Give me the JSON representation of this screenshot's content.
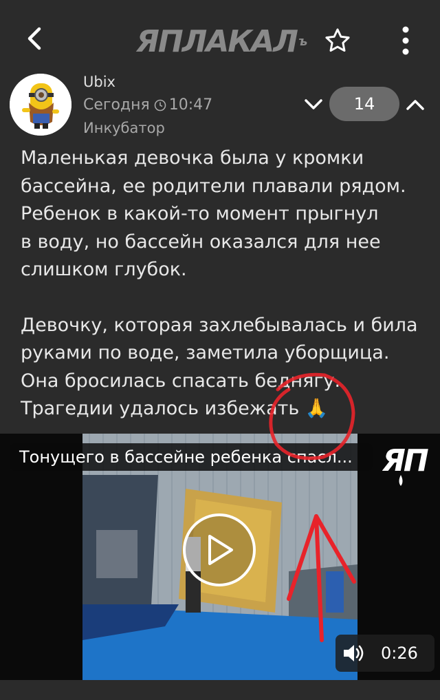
{
  "header": {
    "logo_text": "ЯПЛАКАЛ",
    "logo_sup": "ъ",
    "back_icon": "chevron-left-icon",
    "star_icon": "star-outline-icon",
    "more_icon": "more-vertical-icon"
  },
  "post": {
    "author": "Ubix",
    "time_day": "Сегодня",
    "time_clock": "10:47",
    "author_status": "Инкубатор",
    "rating": "14",
    "paragraphs": [
      "Маленькая девочка была у кромки\nбассейна, ее родители плавали рядом.\nРебенок в какой-то момент прыгнул\nв воду, но бассейн оказался для нее\nслишком глубок.",
      "Девочку, которая захлебывалась и била\nруками по воде, заметила уборщица.\nОна бросилась спасать беднягу.\nТрагедии удалось избежать 🙏"
    ]
  },
  "video": {
    "title": "Тонущего в бассейне ребенка спасл...",
    "logo_text": "ЯП",
    "duration": "0:26"
  },
  "colors": {
    "background": "#2b2b2b",
    "rating_pill": "#6b6b6b",
    "annotation_red": "#e8232a",
    "pool_blue": "#1e74c8"
  }
}
